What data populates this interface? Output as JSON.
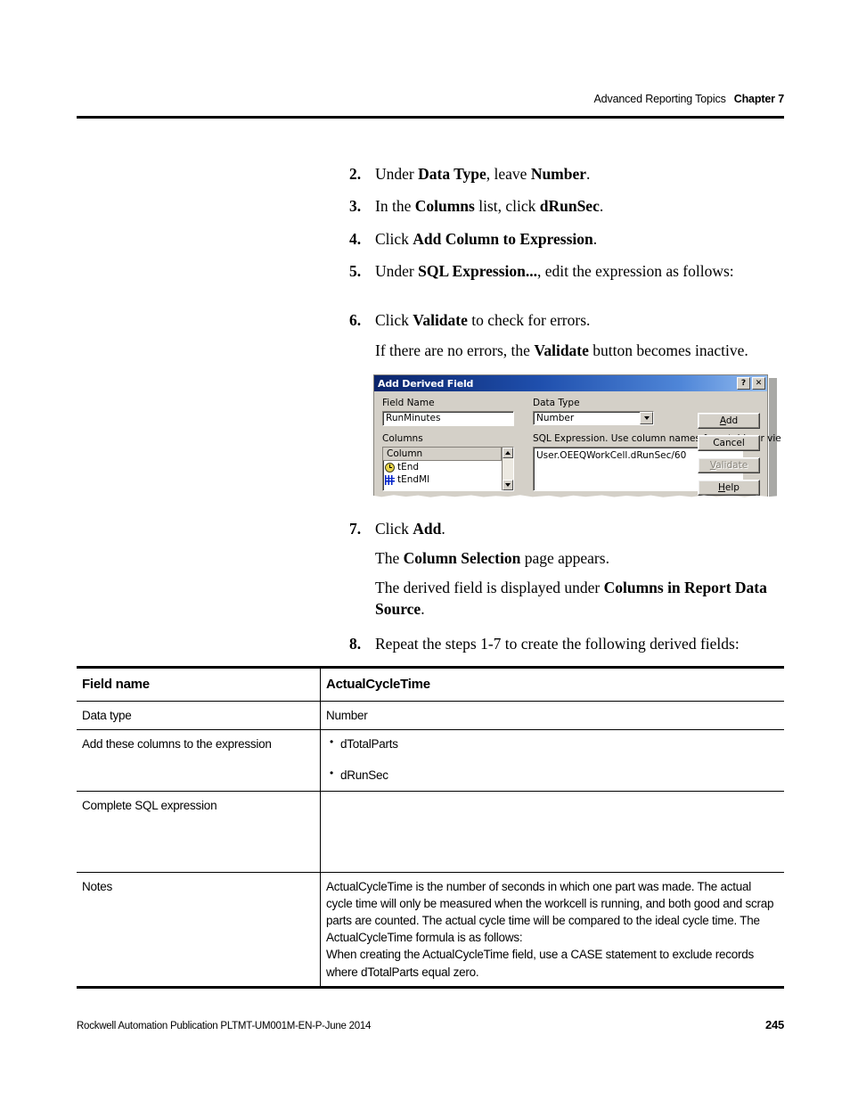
{
  "header": {
    "running_head": "Advanced Reporting Topics",
    "chapter": "Chapter 7"
  },
  "steps": [
    {
      "num": "2.",
      "html": "Under <b>Data Type</b>, leave <b>Number</b>."
    },
    {
      "num": "3.",
      "html": "In the <b>Columns</b> list, click <b>dRunSec</b>."
    },
    {
      "num": "4.",
      "html": "Click <b>Add Column to Expression</b>."
    },
    {
      "num": "5.",
      "html": "Under <b>SQL Expression...</b>, edit the expression as follows:"
    },
    {
      "num": "6.",
      "html": "Click <b>Validate</b> to check for errors."
    }
  ],
  "step6_sub": "If there are no errors, the <b>Validate</b> button becomes inactive.",
  "steps_after": [
    {
      "num": "7.",
      "html": "Click <b>Add</b>."
    }
  ],
  "step7_subs": [
    "The <b>Column Selection</b> page appears.",
    "The derived field is displayed under <b>Columns in Report Data Source</b>."
  ],
  "step8": {
    "num": "8.",
    "html": "Repeat the steps 1-7 to create the following derived fields:"
  },
  "dialog": {
    "title": "Add Derived Field",
    "help_button": "?",
    "close_button": "✕",
    "field_name_label": "Field Name",
    "field_name_value": "RunMinutes",
    "data_type_label": "Data Type",
    "data_type_value": "Number",
    "columns_label": "Columns",
    "columns_header": "Column",
    "columns_items": [
      {
        "label": "tEnd",
        "icon": "clock-icon"
      },
      {
        "label": "tEndMl",
        "icon": "grid-icon"
      }
    ],
    "sql_label": "SQL Expression. Use column names from table or view.",
    "sql_value": "User.OEEQWorkCell.dRunSec/60",
    "buttons": [
      {
        "label": "Add",
        "accel": "A",
        "disabled": false
      },
      {
        "label": "Cancel",
        "accel": "",
        "disabled": false
      },
      {
        "label": "Validate",
        "accel": "V",
        "disabled": true
      },
      {
        "label": "Help",
        "accel": "H",
        "disabled": false
      }
    ],
    "titlebar_color": "#0a246a"
  },
  "table": {
    "head": {
      "label": "Field name",
      "value": "ActualCycleTime"
    },
    "rows": [
      {
        "label": "Data type",
        "value": "Number",
        "bullets": null
      },
      {
        "label": "Add these columns to the expression",
        "value": null,
        "bullets": [
          "dTotalParts",
          "dRunSec"
        ]
      },
      {
        "label": "Complete SQL expression",
        "value": "",
        "bullets": null
      },
      {
        "label": "Notes",
        "value": "ActualCycleTime is the number of seconds in which one part was made. The actual cycle time will only be measured when the workcell is running, and both good and scrap parts are counted. The actual cycle time will be compared to the ideal cycle time. The ActualCycleTime formula is as follows:",
        "value2": "When creating the ActualCycleTime field, use a CASE statement to exclude records where dTotalParts equal zero.",
        "bullets": null
      }
    ]
  },
  "footer": {
    "publication": "Rockwell Automation Publication PLTMT-UM001M-EN-P-June 2014",
    "page_number": "245"
  }
}
